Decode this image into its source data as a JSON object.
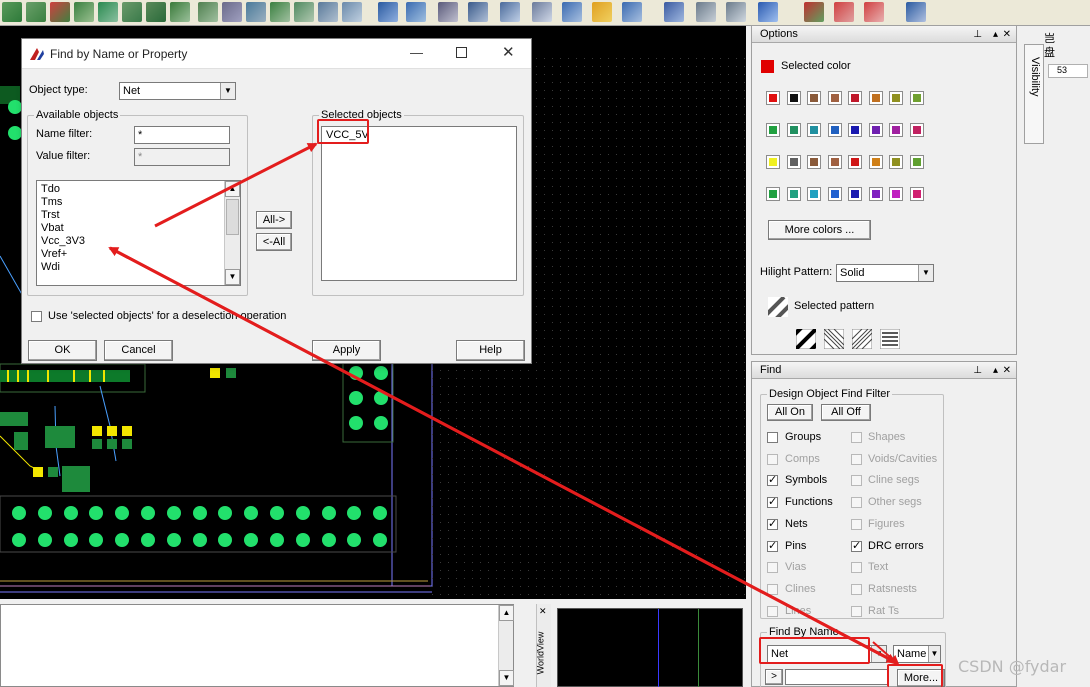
{
  "dialog": {
    "title": "Find by Name or Property",
    "object_type_label": "Object type:",
    "object_type_value": "Net",
    "available_group": "Available objects",
    "name_filter_label": "Name filter:",
    "name_filter_value": "*",
    "value_filter_label": "Value filter:",
    "value_filter_value": "*",
    "available_items": [
      "Tdo",
      "Tms",
      "Trst",
      "Vbat",
      "Vcc_3V3",
      "Vref+",
      "Wdi"
    ],
    "selected_group": "Selected objects",
    "selected_items": [
      "VCC_5V"
    ],
    "all_button": "All->",
    "remove_all_button": "<-All",
    "use_selected_label": "Use 'selected objects' for a deselection operation",
    "ok_button": "OK",
    "cancel_button": "Cancel",
    "apply_button": "Apply",
    "help_button": "Help"
  },
  "options_panel": {
    "title": "Options",
    "selected_color_label": "Selected color",
    "selected_color": "#e00000",
    "more_colors_button": "More colors ...",
    "hilight_pattern_label": "Hilight Pattern:",
    "hilight_pattern_value": "Solid",
    "selected_pattern_label": "Selected pattern",
    "color_rows": [
      [
        "#e01010",
        "#101010",
        "#8a5a3a",
        "#a06040",
        "#c0182a",
        "#c07020",
        "#909020",
        "#70a030"
      ],
      [
        "#20a040",
        "#209060",
        "#2090a0",
        "#2060c0",
        "#1a1ab0",
        "#7020b0",
        "#a020a0",
        "#c02060"
      ],
      [
        "#f0f020",
        "#606060",
        "#8a5a3a",
        "#a06040",
        "#d01818",
        "#d08018",
        "#909020",
        "#60a030"
      ],
      [
        "#20a040",
        "#20a080",
        "#20a0c0",
        "#2060d0",
        "#1a1ab0",
        "#8020c0",
        "#c020c0",
        "#d02070"
      ]
    ]
  },
  "visibility_tab": {
    "label": "Visibility"
  },
  "find_panel": {
    "title": "Find",
    "filter_group": "Design Object Find Filter",
    "all_on_button": "All On",
    "all_off_button": "All Off",
    "left_checks": [
      {
        "label": "Groups",
        "checked": false,
        "enabled": true
      },
      {
        "label": "Comps",
        "checked": false,
        "enabled": false
      },
      {
        "label": "Symbols",
        "checked": true,
        "enabled": true
      },
      {
        "label": "Functions",
        "checked": true,
        "enabled": true
      },
      {
        "label": "Nets",
        "checked": true,
        "enabled": true
      },
      {
        "label": "Pins",
        "checked": true,
        "enabled": true
      },
      {
        "label": "Vias",
        "checked": false,
        "enabled": false
      },
      {
        "label": "Clines",
        "checked": false,
        "enabled": false
      },
      {
        "label": "Lines",
        "checked": false,
        "enabled": false
      }
    ],
    "right_checks": [
      {
        "label": "Shapes",
        "checked": false,
        "enabled": false
      },
      {
        "label": "Voids/Cavities",
        "checked": false,
        "enabled": false
      },
      {
        "label": "Cline segs",
        "checked": false,
        "enabled": false
      },
      {
        "label": "Other segs",
        "checked": false,
        "enabled": false
      },
      {
        "label": "Figures",
        "checked": false,
        "enabled": false
      },
      {
        "label": "DRC errors",
        "checked": true,
        "enabled": true
      },
      {
        "label": "Text",
        "checked": false,
        "enabled": false
      },
      {
        "label": "Ratsnests",
        "checked": false,
        "enabled": false
      },
      {
        "label": "Rat Ts",
        "checked": false,
        "enabled": false
      }
    ],
    "find_by_name_group": "Find By Name",
    "type_value": "Net",
    "mode_value": "Name",
    "more_button": "More...",
    "expand_glyph": ">"
  },
  "worldview_tab": {
    "label": "WorldView"
  },
  "side_fragments": {
    "cn_top": "岂",
    "cn_bottom": "盘",
    "num": "53"
  },
  "watermark": "CSDN @fydar",
  "annotation_color": "#e31d1d"
}
